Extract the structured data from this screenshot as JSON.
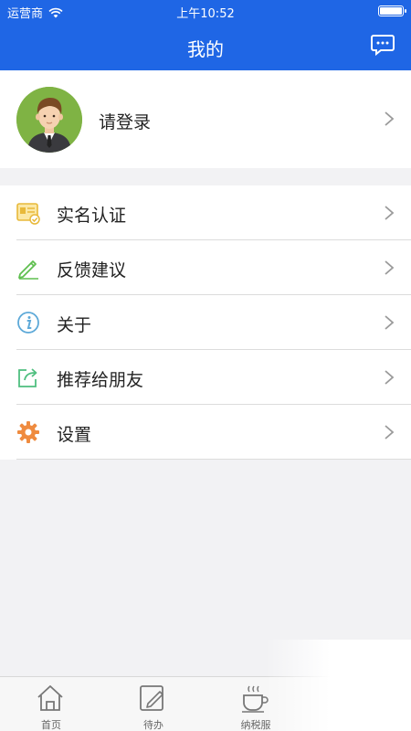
{
  "status_bar": {
    "carrier": "运营商",
    "time": "上午10:52",
    "icons": [
      "wifi-icon",
      "battery-icon"
    ]
  },
  "nav": {
    "title": "我的",
    "message_icon": "message-icon"
  },
  "profile": {
    "login_label": "请登录",
    "avatar_icon": "avatar"
  },
  "menu": {
    "items": [
      {
        "label": "实名认证",
        "icon": "id-card-icon"
      },
      {
        "label": "反馈建议",
        "icon": "pencil-icon"
      },
      {
        "label": "关于",
        "icon": "info-icon"
      },
      {
        "label": "推荐给朋友",
        "icon": "share-icon"
      },
      {
        "label": "设置",
        "icon": "gear-icon"
      }
    ]
  },
  "tabbar": {
    "tabs": [
      {
        "label": "首页",
        "icon": "home-icon"
      },
      {
        "label": "待办",
        "icon": "edit-icon"
      },
      {
        "label": "纳税服",
        "icon": "coffee-cup-icon"
      }
    ]
  },
  "colors": {
    "primary": "#1f66e5",
    "avatar_bg": "#7fb344",
    "id_card": "#e8b93a",
    "pencil": "#5fbf4f",
    "info": "#5da9d8",
    "share": "#4fbf7f",
    "gear": "#ef8b3f"
  }
}
